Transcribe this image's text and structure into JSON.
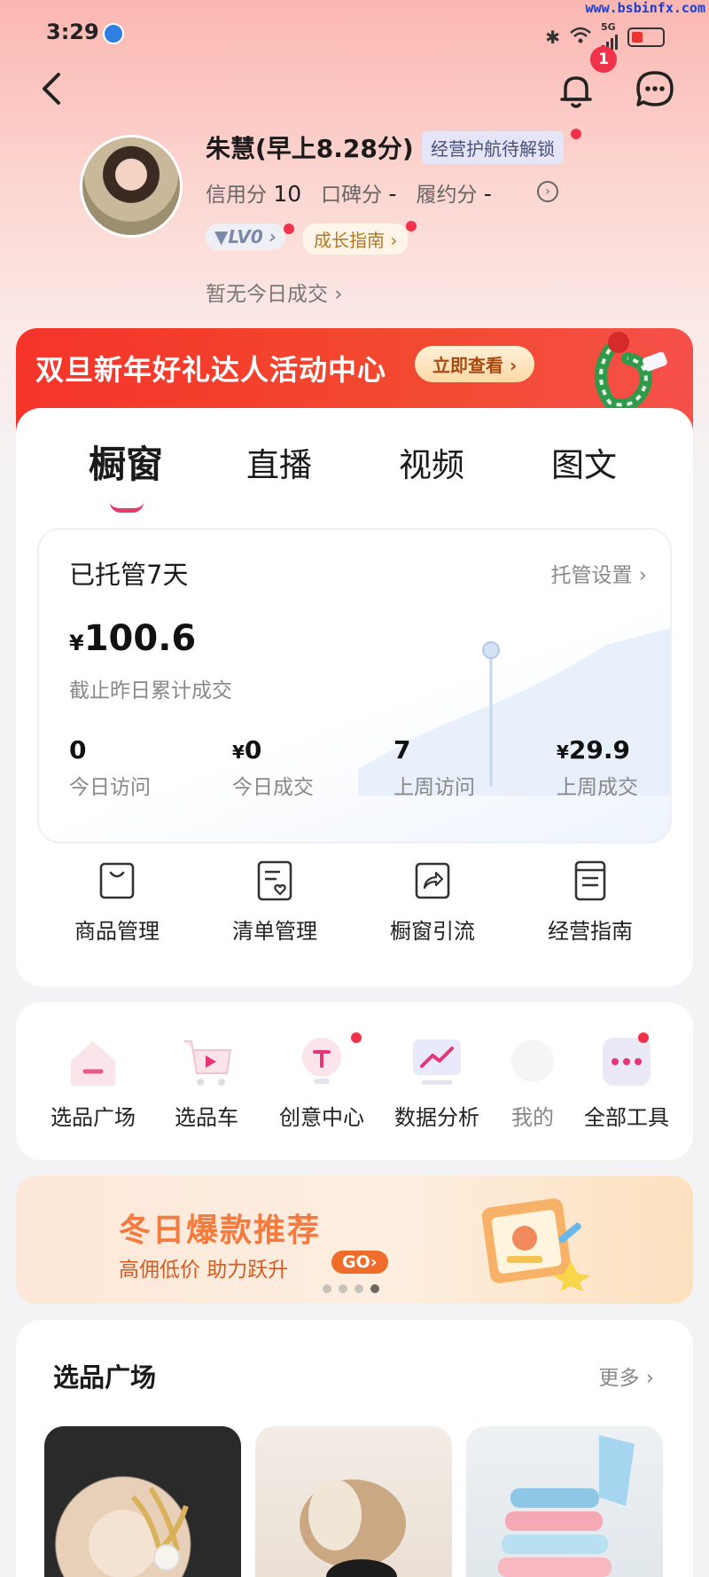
{
  "watermark": "www.bsbinfx.com",
  "status_bar": {
    "time": "3:29",
    "network": "5G"
  },
  "header": {
    "notification_count": "1"
  },
  "profile": {
    "name": "朱慧(早上8.28分)",
    "unlock_tag": "经营护航待解锁",
    "credit_label": "信用分",
    "credit_value": "10",
    "reputation_label": "口碑分",
    "reputation_value": "-",
    "fulfillment_label": "履约分",
    "fulfillment_value": "-",
    "level": "LV0",
    "growth_guide": "成长指南",
    "today_deal": "暂无今日成交"
  },
  "activity_banner": {
    "title": "双旦新年好礼达人活动中心",
    "button": "立即查看"
  },
  "tabs": [
    "橱窗",
    "直播",
    "视频",
    "图文"
  ],
  "stats": {
    "managed_days": "已托管7天",
    "settings": "托管设置",
    "currency": "¥",
    "cumulative_amount": "100.6",
    "cumulative_label": "截止昨日累计成交",
    "items": [
      {
        "prefix": "",
        "value": "0",
        "label": "今日访问"
      },
      {
        "prefix": "¥",
        "value": "0",
        "label": "今日成交"
      },
      {
        "prefix": "",
        "value": "7",
        "label": "上周访问"
      },
      {
        "prefix": "¥",
        "value": "29.9",
        "label": "上周成交"
      }
    ]
  },
  "shortcuts": [
    "商品管理",
    "清单管理",
    "橱窗引流",
    "经营指南"
  ],
  "tools": [
    "选品广场",
    "选品车",
    "创意中心",
    "数据分析",
    "我的",
    "全部工具"
  ],
  "winter_banner": {
    "title": "冬日爆款推荐",
    "subtitle": "高佣低价 助力跃升",
    "go": "GO"
  },
  "plaza": {
    "title": "选品广场",
    "more": "更多"
  },
  "colors": {
    "accent_red": "#f0334a",
    "banner_red": "#f5342a",
    "winter_orange": "#f47a3e"
  }
}
